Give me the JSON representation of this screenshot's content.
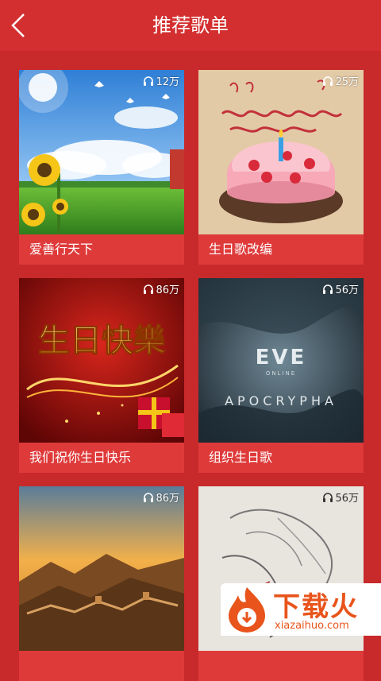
{
  "header": {
    "title": "推荐歌单"
  },
  "playlists": [
    {
      "name": "爱善行天下",
      "plays": "12万",
      "art": "sunflower-meadow"
    },
    {
      "name": "生日歌改编",
      "plays": "25万",
      "art": "birthday-cake"
    },
    {
      "name": "我们祝你生日快乐",
      "plays": "86万",
      "art": "birthday-greeting",
      "art_text": "生日快樂"
    },
    {
      "name": "组织生日歌",
      "plays": "56万",
      "art": "eve-apocrypha",
      "art_text": [
        "EVE",
        "ONLINE",
        "APOCRYPHA"
      ]
    },
    {
      "name": "",
      "plays": "86万",
      "art": "great-wall-sunset"
    },
    {
      "name": "",
      "plays": "56万",
      "art": "hand-sketch"
    }
  ],
  "watermark": {
    "title": "下载火",
    "url": "xiazaihuo.com"
  },
  "colors": {
    "background": "#c8292b",
    "header": "#d42f30",
    "card_label_bg": "#df3a3a",
    "watermark": "#e8541b"
  }
}
